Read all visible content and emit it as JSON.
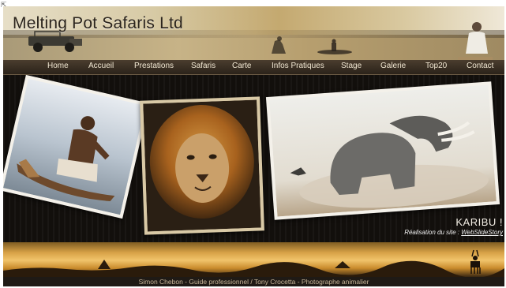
{
  "site": {
    "title": "Melting Pot Safaris Ltd"
  },
  "nav": {
    "items": [
      {
        "label": "Home"
      },
      {
        "label": "Accueil"
      },
      {
        "label": "Prestations"
      },
      {
        "label": "Safaris"
      },
      {
        "label": "Carte"
      },
      {
        "label": "Infos Pratiques"
      },
      {
        "label": "Stage"
      },
      {
        "label": "Galerie"
      },
      {
        "label": "Top20"
      },
      {
        "label": "Contact"
      }
    ]
  },
  "main": {
    "greeting": "KARIBU !",
    "credit_prefix": "Réalisation du site : ",
    "credit_link": "WebSlideStory"
  },
  "footer": {
    "text": "Simon Chebon - Guide professionnel  /  Tony Crocetta - Photographe animalier"
  },
  "icons": {
    "jeep": "safari-jeep-icon",
    "antelope": "antelope-silhouette-icon"
  },
  "colors": {
    "nav_text": "#f1e7d2",
    "nav_bg": "#2b231a",
    "background": "#14110e",
    "sunset": "#f1c46b"
  }
}
